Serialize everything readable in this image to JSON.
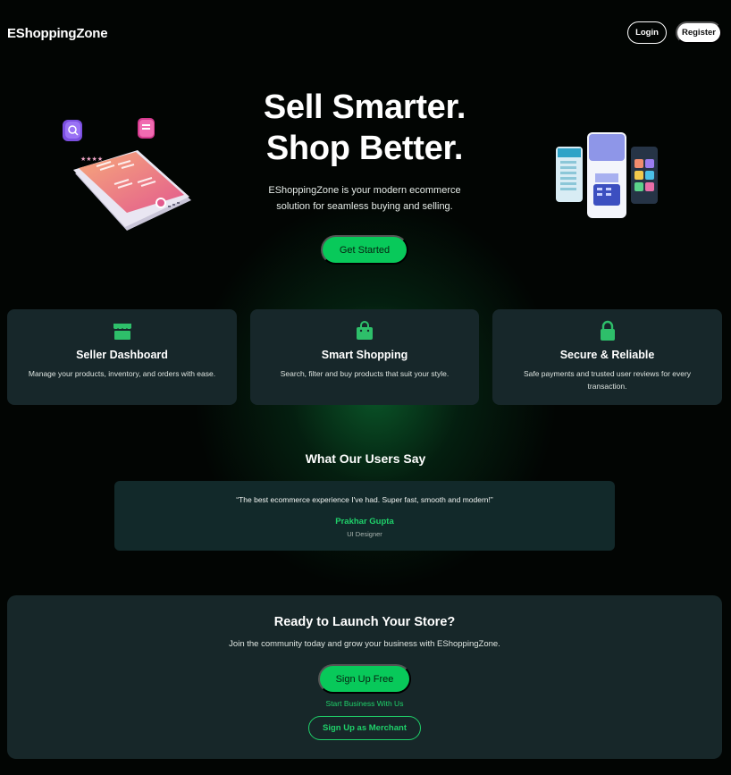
{
  "navbar": {
    "brand": "EShoppingZone",
    "login_label": "Login",
    "register_label": "Register"
  },
  "hero": {
    "title_line1": "Sell Smarter.",
    "title_line2": "Shop Better.",
    "description": "EShoppingZone is your modern ecommerce solution for seamless buying and selling.",
    "cta_label": "Get Started"
  },
  "features": [
    {
      "icon": "store-icon",
      "title": "Seller Dashboard",
      "description": "Manage your products, inventory, and orders with ease."
    },
    {
      "icon": "shopping-bag-icon",
      "title": "Smart Shopping",
      "description": "Search, filter and buy products that suit your style."
    },
    {
      "icon": "lock-icon",
      "title": "Secure & Reliable",
      "description": "Safe payments and trusted user reviews for every transaction."
    }
  ],
  "testimonials": {
    "heading": "What Our Users Say",
    "quote": "“The best ecommerce experience I've had. Super fast, smooth and modern!”",
    "name": "Prakhar Gupta",
    "role": "UI Designer"
  },
  "cta": {
    "title": "Ready to Launch Your Store?",
    "description": "Join the community today and grow your business with EShoppingZone.",
    "signup_label": "Sign Up Free",
    "business_link": "Start Business With Us",
    "merchant_label": "Sign Up as Merchant"
  },
  "colors": {
    "accent": "#08c95a",
    "card_bg": "#17272a",
    "background": "#020503"
  }
}
